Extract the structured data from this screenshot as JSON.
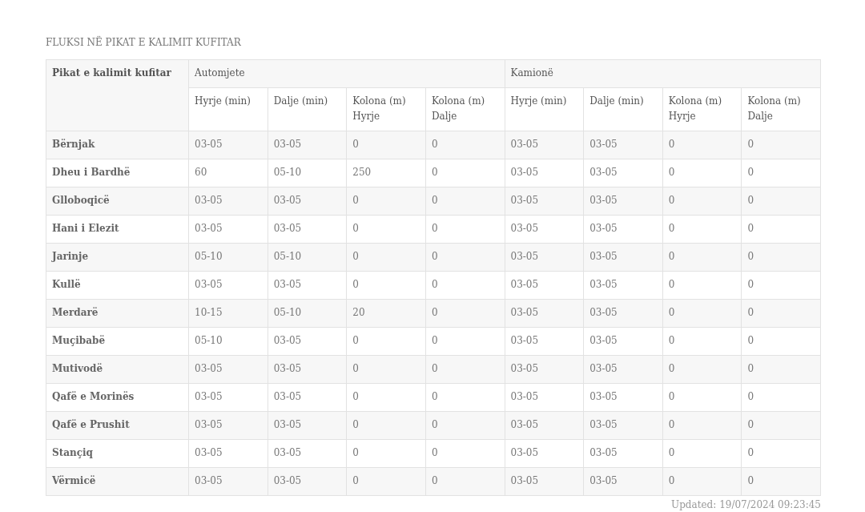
{
  "title": "FLUKSI NË PIKAT E KALIMIT KUFITAR",
  "table": {
    "corner_header": "Pikat e kalimit kufitar",
    "groups": [
      {
        "label": "Automjete",
        "columns": [
          "Hyrje (min)",
          "Dalje (min)",
          "Kolona (m) Hyrje",
          "Kolona (m) Dalje"
        ]
      },
      {
        "label": "Kamionë",
        "columns": [
          "Hyrje (min)",
          "Dalje (min)",
          "Kolona (m) Hyrje",
          "Kolona (m) Dalje"
        ]
      }
    ],
    "rows": [
      {
        "name": "Bërnjak",
        "cells": [
          "03-05",
          "03-05",
          "0",
          "0",
          "03-05",
          "03-05",
          "0",
          "0"
        ]
      },
      {
        "name": "Dheu i Bardhë",
        "cells": [
          "60",
          "05-10",
          "250",
          "0",
          "03-05",
          "03-05",
          "0",
          "0"
        ]
      },
      {
        "name": "Glloboqicë",
        "cells": [
          "03-05",
          "03-05",
          "0",
          "0",
          "03-05",
          "03-05",
          "0",
          "0"
        ]
      },
      {
        "name": "Hani i Elezit",
        "cells": [
          "03-05",
          "03-05",
          "0",
          "0",
          "03-05",
          "03-05",
          "0",
          "0"
        ]
      },
      {
        "name": "Jarinje",
        "cells": [
          "05-10",
          "05-10",
          "0",
          "0",
          "03-05",
          "03-05",
          "0",
          "0"
        ]
      },
      {
        "name": "Kullë",
        "cells": [
          "03-05",
          "03-05",
          "0",
          "0",
          "03-05",
          "03-05",
          "0",
          "0"
        ]
      },
      {
        "name": "Merdarë",
        "cells": [
          "10-15",
          "05-10",
          "20",
          "0",
          "03-05",
          "03-05",
          "0",
          "0"
        ]
      },
      {
        "name": "Muçibabë",
        "cells": [
          "05-10",
          "03-05",
          "0",
          "0",
          "03-05",
          "03-05",
          "0",
          "0"
        ]
      },
      {
        "name": "Mutivodë",
        "cells": [
          "03-05",
          "03-05",
          "0",
          "0",
          "03-05",
          "03-05",
          "0",
          "0"
        ]
      },
      {
        "name": "Qafë e Morinës",
        "cells": [
          "03-05",
          "03-05",
          "0",
          "0",
          "03-05",
          "03-05",
          "0",
          "0"
        ]
      },
      {
        "name": "Qafë e Prushit",
        "cells": [
          "03-05",
          "03-05",
          "0",
          "0",
          "03-05",
          "03-05",
          "0",
          "0"
        ]
      },
      {
        "name": "Stançiq",
        "cells": [
          "03-05",
          "03-05",
          "0",
          "0",
          "03-05",
          "03-05",
          "0",
          "0"
        ]
      },
      {
        "name": "Vërmicë",
        "cells": [
          "03-05",
          "03-05",
          "0",
          "0",
          "03-05",
          "03-05",
          "0",
          "0"
        ]
      }
    ]
  },
  "updated": "Updated: 19/07/2024 09:23:45"
}
